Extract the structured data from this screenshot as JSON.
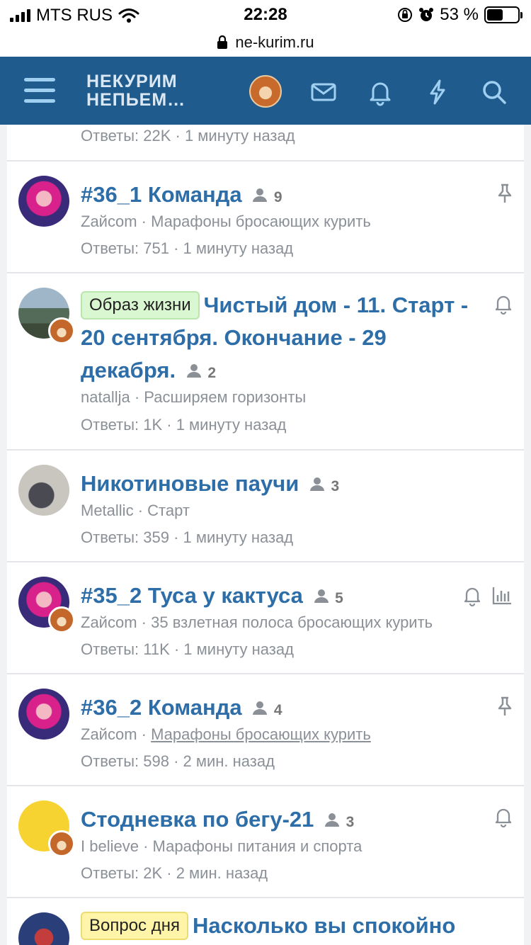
{
  "status_bar": {
    "carrier": "MTS RUS",
    "time": "22:28",
    "battery_percent": "53 %",
    "battery_level": 0.53
  },
  "url_bar": {
    "domain": "ne-kurim.ru"
  },
  "header": {
    "logo_line1": "НЕКУРИМ",
    "logo_line2": "НЕПЬЕМ…",
    "colors": {
      "header_bg": "#1f5b8c",
      "icon": "#9fd0f2",
      "title": "#2e6ea8"
    }
  },
  "threads": [
    {
      "meta2": "Ответы: 22K · 1 минуту назад"
    },
    {
      "title": "#36_1 Команда",
      "participants": "9",
      "author": "Zaйcom",
      "forum": "Марафоны бросающих курить",
      "stats": "Ответы: 751 · 1 минуту назад",
      "icons": [
        "pin-icon"
      ]
    },
    {
      "prefix": "Образ жизни",
      "title": "Чистый дом - 11. Старт - 20 сентября. Окончание - 29 декабря.",
      "participants": "2",
      "author": "natallja",
      "forum": "Расширяем горизонты",
      "stats": "Ответы: 1K · 1 минуту назад",
      "icons": [
        "bell-icon"
      ]
    },
    {
      "title": "Никотиновые паучи",
      "participants": "3",
      "author": "Metallic",
      "forum": "Старт",
      "stats": "Ответы: 359 · 1 минуту назад"
    },
    {
      "title": "#35_2 Туса у кактуса",
      "participants": "5",
      "author": "Zaйcom",
      "forum": "35 взлетная полоса бросающих курить",
      "stats": "Ответы: 11K · 1 минуту назад",
      "icons": [
        "bell-icon",
        "poll-icon"
      ]
    },
    {
      "title": "#36_2 Команда",
      "participants": "4",
      "author": "Zaйcom",
      "forum": "Марафоны бросающих курить",
      "stats": "Ответы: 598 · 2 мин. назад",
      "icons": [
        "pin-icon"
      ]
    },
    {
      "title": "Стодневка по бегу-21",
      "participants": "3",
      "author": "I believe",
      "forum": "Марафоны питания и спорта",
      "stats": "Ответы: 2K · 2 мин. назад",
      "icons": [
        "bell-icon"
      ]
    },
    {
      "prefix": "Вопрос дня",
      "title": "Насколько вы спокойно"
    }
  ]
}
